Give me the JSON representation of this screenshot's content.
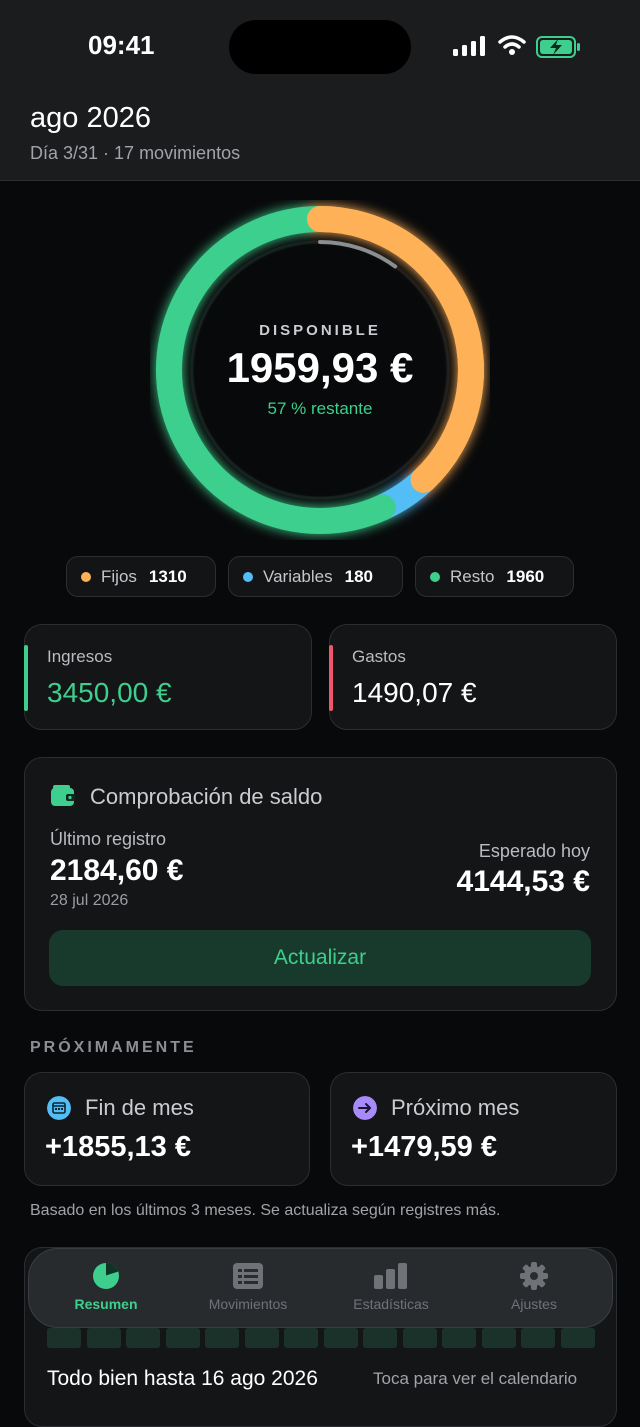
{
  "status_bar": {
    "time": "09:41"
  },
  "header": {
    "month": "ago 2026",
    "subtitle": "Día 3/31 · 17 movimientos"
  },
  "ring": {
    "label": "DISPONIBLE",
    "amount": "1959,93 €",
    "remaining": "57 % restante",
    "progress_fraction": 0.1
  },
  "legend": [
    {
      "label": "Fijos",
      "value": "1310",
      "color": "#ffb158"
    },
    {
      "label": "Variables",
      "value": "180",
      "color": "#53bdf5"
    },
    {
      "label": "Resto",
      "value": "1960",
      "color": "#3ecf8e"
    }
  ],
  "income": {
    "label": "Ingresos",
    "value": "3450,00 €",
    "color": "#3ecf8e"
  },
  "expenses": {
    "label": "Gastos",
    "value": "1490,07 €",
    "color": "#f0566b"
  },
  "balance_check": {
    "title": "Comprobación de saldo",
    "last_label": "Último registro",
    "last_amount": "2184,60 €",
    "last_date": "28 jul 2026",
    "expected_label": "Esperado hoy",
    "expected_amount": "4144,53 €",
    "button": "Actualizar"
  },
  "upcoming": {
    "heading": "PRÓXIMAMENTE",
    "end_of_month": {
      "title": "Fin de mes",
      "value": "+1855,13 €"
    },
    "next_month": {
      "title": "Próximo mes",
      "value": "+1479,59 €"
    },
    "footnote": "Basado en los últimos 3 meses. Se actualiza según registres más."
  },
  "calendar": {
    "status": "Todo bien hasta 16 ago 2026",
    "hint": "Toca para ver el calendario"
  },
  "tabs": [
    {
      "label": "Resumen",
      "icon": "pie-chart-icon",
      "active": true
    },
    {
      "label": "Movimientos",
      "icon": "list-icon",
      "active": false
    },
    {
      "label": "Estadísticas",
      "icon": "bar-chart-icon",
      "active": false
    },
    {
      "label": "Ajustes",
      "icon": "gear-icon",
      "active": false
    }
  ]
}
